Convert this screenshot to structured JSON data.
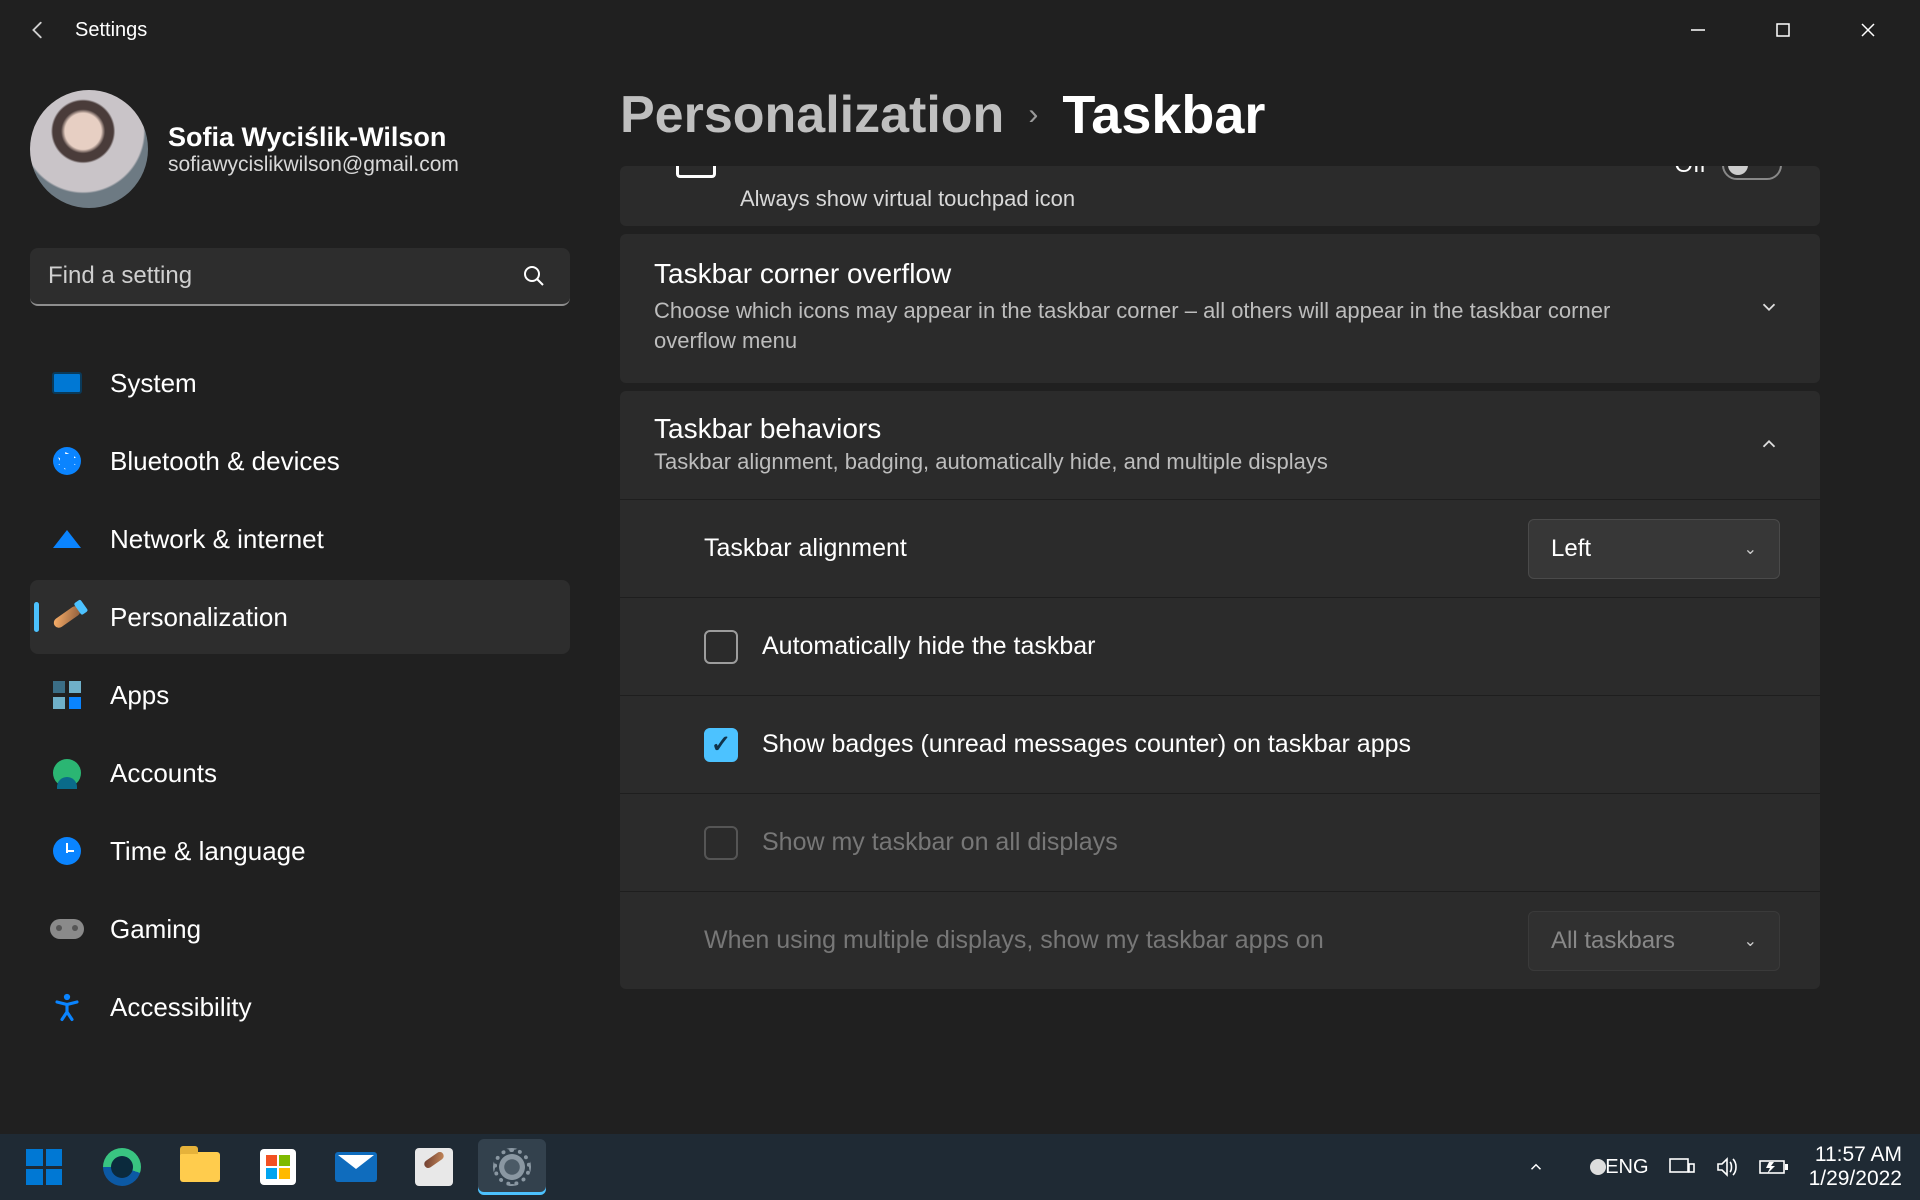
{
  "app": {
    "name": "Settings"
  },
  "user": {
    "name": "Sofia Wyciślik-Wilson",
    "email": "sofiawycislikwilson@gmail.com"
  },
  "search": {
    "placeholder": "Find a setting"
  },
  "nav": {
    "items": [
      {
        "label": "System"
      },
      {
        "label": "Bluetooth & devices"
      },
      {
        "label": "Network & internet"
      },
      {
        "label": "Personalization"
      },
      {
        "label": "Apps"
      },
      {
        "label": "Accounts"
      },
      {
        "label": "Time & language"
      },
      {
        "label": "Gaming"
      },
      {
        "label": "Accessibility"
      }
    ]
  },
  "breadcrumb": {
    "parent": "Personalization",
    "current": "Taskbar"
  },
  "partial": {
    "desc": "Always show virtual touchpad icon",
    "toggle_label": "Off"
  },
  "overflow": {
    "title": "Taskbar corner overflow",
    "desc": "Choose which icons may appear in the taskbar corner – all others will appear in the taskbar corner overflow menu"
  },
  "behaviors": {
    "title": "Taskbar behaviors",
    "desc": "Taskbar alignment, badging, automatically hide, and multiple displays",
    "alignment_label": "Taskbar alignment",
    "alignment_value": "Left",
    "auto_hide": "Automatically hide the taskbar",
    "badges": "Show badges (unread messages counter) on taskbar apps",
    "all_displays": "Show my taskbar on all displays",
    "multi_label": "When using multiple displays, show my taskbar apps on",
    "multi_value": "All taskbars"
  },
  "tray": {
    "lang": "ENG",
    "time": "11:57 AM",
    "date": "1/29/2022"
  }
}
